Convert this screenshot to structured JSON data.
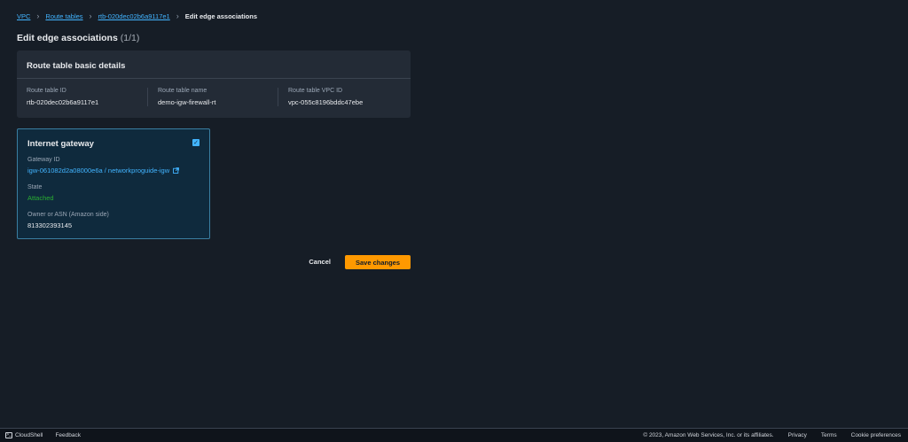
{
  "breadcrumb": {
    "items": [
      "VPC",
      "Route tables",
      "rtb-020dec02b6a9117e1"
    ],
    "current": "Edit edge associations"
  },
  "page": {
    "title": "Edit edge associations",
    "count": "(1/1)"
  },
  "details": {
    "header": "Route table basic details",
    "columns": [
      {
        "label": "Route table ID",
        "value": "rtb-020dec02b6a9117e1"
      },
      {
        "label": "Route table name",
        "value": "demo-igw-firewall-rt"
      },
      {
        "label": "Route table VPC ID",
        "value": "vpc-055c8196bddc47ebe"
      }
    ]
  },
  "igw": {
    "title": "Internet gateway",
    "checked": true,
    "gateway_id_label": "Gateway ID",
    "gateway_id_value": "igw-061082d2a08000e6a / networkproguide-igw",
    "state_label": "State",
    "state_value": "Attached",
    "owner_label": "Owner or ASN (Amazon side)",
    "owner_value": "813302393145",
    "state_color": "#29ad32",
    "link_color": "#42b4ff"
  },
  "actions": {
    "cancel": "Cancel",
    "save": "Save changes",
    "save_color": "#ff9900"
  },
  "footer": {
    "cloudshell": "CloudShell",
    "feedback": "Feedback",
    "copyright": "© 2023, Amazon Web Services, Inc. or its affiliates.",
    "privacy": "Privacy",
    "terms": "Terms",
    "cookie": "Cookie preferences"
  }
}
